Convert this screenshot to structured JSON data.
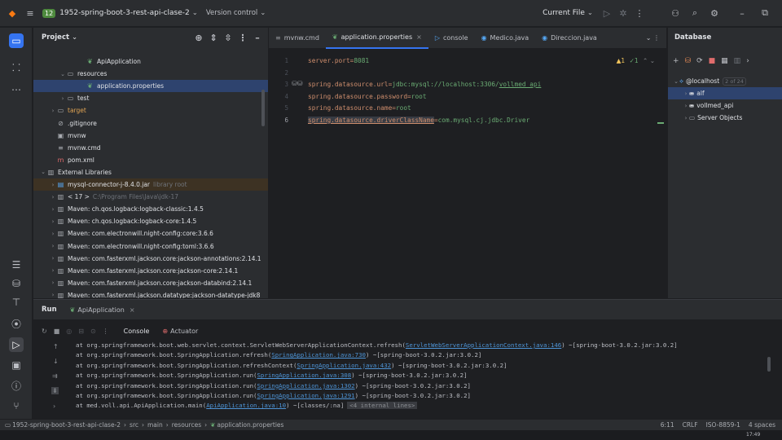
{
  "titlebar": {
    "project_badge": "12",
    "project_name": "1952-spring-boot-3-rest-api-clase-2",
    "vcs_label": "Version control",
    "current_file_label": "Current File"
  },
  "project_panel": {
    "title": "Project",
    "rows": [
      {
        "label": "ApiApplication",
        "indent": 4,
        "icon": "spring-icon"
      },
      {
        "label": "resources",
        "indent": 2,
        "icon": "folder-icon",
        "chev": "v"
      },
      {
        "label": "application.properties",
        "indent": 4,
        "icon": "leaf-icon",
        "selected": true
      },
      {
        "label": "test",
        "indent": 2,
        "icon": "folder-icon",
        "chev": ">"
      },
      {
        "label": "target",
        "indent": 1,
        "icon": "folder-icon",
        "chev": ">",
        "orange": true
      },
      {
        "label": ".gitignore",
        "indent": 1,
        "icon": "ignore-icon"
      },
      {
        "label": "mvnw",
        "indent": 1,
        "icon": "terminal-icon"
      },
      {
        "label": "mvnw.cmd",
        "indent": 1,
        "icon": "text-icon"
      },
      {
        "label": "pom.xml",
        "indent": 1,
        "icon": "maven-icon"
      },
      {
        "label": "External Libraries",
        "indent": 0,
        "icon": "library-icon",
        "chev": "v"
      },
      {
        "label": "mysql-connector-j-8.4.0.jar",
        "extra": "library root",
        "indent": 1,
        "icon": "jar-icon",
        "chev": ">",
        "lib": true
      },
      {
        "label": "< 17 >",
        "extra": "C:\\Program Files\\Java\\jdk-17",
        "indent": 1,
        "icon": "library-icon",
        "chev": ">"
      },
      {
        "label": "Maven: ch.qos.logback:logback-classic:1.4.5",
        "indent": 1,
        "icon": "library-icon",
        "chev": ">"
      },
      {
        "label": "Maven: ch.qos.logback:logback-core:1.4.5",
        "indent": 1,
        "icon": "library-icon",
        "chev": ">"
      },
      {
        "label": "Maven: com.electronwill.night-config:core:3.6.6",
        "indent": 1,
        "icon": "library-icon",
        "chev": ">"
      },
      {
        "label": "Maven: com.electronwill.night-config:toml:3.6.6",
        "indent": 1,
        "icon": "library-icon",
        "chev": ">"
      },
      {
        "label": "Maven: com.fasterxml.jackson.core:jackson-annotations:2.14.1",
        "indent": 1,
        "icon": "library-icon",
        "chev": ">"
      },
      {
        "label": "Maven: com.fasterxml.jackson.core:jackson-core:2.14.1",
        "indent": 1,
        "icon": "library-icon",
        "chev": ">"
      },
      {
        "label": "Maven: com.fasterxml.jackson.core:jackson-databind:2.14.1",
        "indent": 1,
        "icon": "library-icon",
        "chev": ">"
      },
      {
        "label": "Maven: com.fasterxml.jackson.datatype:jackson-datatype-jdk8",
        "indent": 1,
        "icon": "library-icon",
        "chev": ">"
      }
    ]
  },
  "editor": {
    "tabs": [
      {
        "label": "mvnw.cmd",
        "icon": "text-icon"
      },
      {
        "label": "application.properties",
        "icon": "leaf-icon",
        "active": true
      },
      {
        "label": "console",
        "icon": "console-icon"
      },
      {
        "label": "Medico.java",
        "icon": "class-icon"
      },
      {
        "label": "Direccion.java",
        "icon": "class-icon"
      }
    ],
    "warning_count": "1",
    "check_count": "1",
    "lines": [
      {
        "num": "1",
        "key": "server.port=",
        "value": "8081"
      },
      {
        "num": "2",
        "key": "",
        "value": ""
      },
      {
        "num": "3",
        "key": "spring.datasource.url=",
        "value": "jdbc:mysql://localhost:3306/",
        "underlined": "vollmed_api"
      },
      {
        "num": "4",
        "key": "spring.datasource.password=",
        "value": "root"
      },
      {
        "num": "5",
        "key": "spring.datasource.name=",
        "value": "root"
      },
      {
        "num": "6",
        "key": "spring.datasource.driverClassName",
        "sep": "=",
        "value": "com.mysql.cj.jdbc.Driver",
        "highlight": true
      }
    ]
  },
  "database": {
    "title": "Database",
    "host": "@localhost",
    "host_count": "2 of 24",
    "items": [
      "alf",
      "vollmed_api",
      "Server Objects"
    ]
  },
  "run": {
    "tab_label": "Run",
    "config_name": "ApiApplication",
    "console_label": "Console",
    "actuator_label": "Actuator",
    "lines": [
      {
        "pre": "at org.springframework.boot.web.servlet.context.ServletWebServerApplicationContext.refresh(",
        "link": "ServletWebServerApplicationContext.java:146",
        "post": ") ~[spring-boot-3.0.2.jar:3.0.2]"
      },
      {
        "pre": "at org.springframework.boot.SpringApplication.refresh(",
        "link": "SpringApplication.java:730",
        "post": ") ~[spring-boot-3.0.2.jar:3.0.2]"
      },
      {
        "pre": "at org.springframework.boot.SpringApplication.refreshContext(",
        "link": "SpringApplication.java:432",
        "post": ") ~[spring-boot-3.0.2.jar:3.0.2]"
      },
      {
        "pre": "at org.springframework.boot.SpringApplication.run(",
        "link": "SpringApplication.java:308",
        "post": ") ~[spring-boot-3.0.2.jar:3.0.2]"
      },
      {
        "pre": "at org.springframework.boot.SpringApplication.run(",
        "link": "SpringApplication.java:1302",
        "post": ") ~[spring-boot-3.0.2.jar:3.0.2]"
      },
      {
        "pre": "at org.springframework.boot.SpringApplication.run(",
        "link": "SpringApplication.java:1291",
        "post": ") ~[spring-boot-3.0.2.jar:3.0.2]"
      },
      {
        "pre": "at med.voll.api.ApiApplication.main(",
        "link": "ApiApplication.java:10",
        "post": ") ~[classes/:na]",
        "fold": "<4 internal lines>"
      }
    ]
  },
  "statusbar": {
    "breadcrumb": [
      "1952-spring-boot-3-rest-api-clase-2",
      "src",
      "main",
      "resources",
      "application.properties"
    ],
    "position": "6:11",
    "line_sep": "CRLF",
    "encoding": "ISO-8859-1",
    "indent": "4 spaces"
  },
  "taskbar": {
    "clock": "17:49"
  },
  "colors": {
    "accent": "#3574f0",
    "background": "#1e1f22",
    "panel": "#2b2d30",
    "property_key": "#cf8e6d",
    "property_value": "#6aab73",
    "link": "#56a8f5"
  }
}
